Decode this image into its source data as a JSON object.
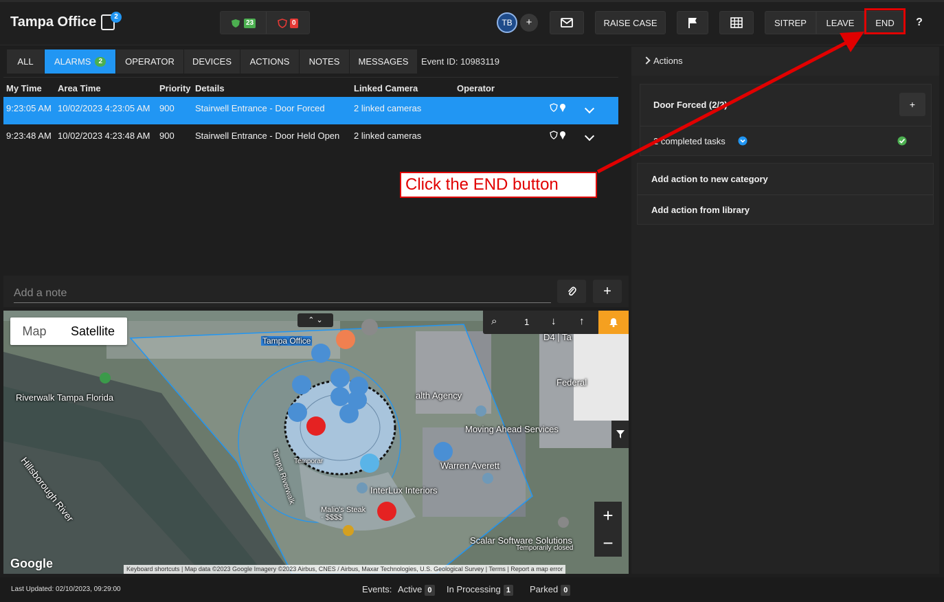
{
  "header": {
    "title": "Tampa Office",
    "notif_count": "2",
    "status_ok_count": "23",
    "status_alert_count": "0",
    "avatar_initials": "TB",
    "avatar_add": "+",
    "raise_case": "RAISE CASE",
    "sitrep": "SITREP",
    "leave": "LEAVE",
    "end": "END",
    "help": "?"
  },
  "tabs": [
    {
      "label": "ALL"
    },
    {
      "label": "ALARMS",
      "badge": "2"
    },
    {
      "label": "OPERATOR"
    },
    {
      "label": "DEVICES"
    },
    {
      "label": "ACTIONS"
    },
    {
      "label": "NOTES"
    },
    {
      "label": "MESSAGES"
    }
  ],
  "event_id": "Event ID: 10983119",
  "table": {
    "headers": [
      "My Time",
      "Area Time",
      "Priority",
      "Details",
      "Linked Camera",
      "Operator"
    ],
    "rows": [
      {
        "my_time": "9:23:05 AM",
        "area_time": "10/02/2023 4:23:05 AM",
        "priority": "900",
        "details": "Stairwell Entrance - Door Forced",
        "camera": "2 linked cameras"
      },
      {
        "my_time": "9:23:48 AM",
        "area_time": "10/02/2023 4:23:48 AM",
        "priority": "900",
        "details": "Stairwell Entrance - Door Held Open",
        "camera": "2 linked cameras"
      }
    ]
  },
  "note": {
    "placeholder": "Add a note",
    "add": "+"
  },
  "map": {
    "toggle_map": "Map",
    "toggle_satellite": "Satellite",
    "zoom_level": "1",
    "labels": {
      "tampa_office": "Tampa Office",
      "riverwalk": "Riverwalk Tampa Florida",
      "river": "Hillsborough River",
      "health": "alth Agency",
      "moving": "Moving Ahead Services",
      "warren": "Warren Averett",
      "interlux": "InterLux Interiors",
      "tampa_riverwalk": "Tampa Riverwalk",
      "malios": "Malio's Steak · $$$$",
      "temporary": "Temporar",
      "scalar": "Scalar Software Solutions",
      "temp_closed": "Temporarily closed",
      "federal": "Federal",
      "d4": "D4 | Ta",
      "google": "Google"
    },
    "attribution": "Keyboard shortcuts | Map data ©2023 Google Imagery ©2023 Airbus, CNES / Airbus, Maxar Technologies, U.S. Geological Survey | Terms | Report a map error",
    "zoom_in": "+",
    "zoom_out": "−"
  },
  "actions_panel": {
    "title": "Actions",
    "category": "Door Forced (2/2)",
    "category_add": "+",
    "completed": "2 completed tasks",
    "add_category": "Add action to new category",
    "add_library": "Add action from library"
  },
  "footer": {
    "last_updated": "Last Updated: 02/10/2023, 09:29:00",
    "events_label": "Events:",
    "active_label": "Active",
    "active_count": "0",
    "processing_label": "In Processing",
    "processing_count": "1",
    "parked_label": "Parked",
    "parked_count": "0"
  },
  "annotation": {
    "text": "Click the END button"
  },
  "colors": {
    "accent": "#2196f3",
    "ok": "#4caf50",
    "alert": "#e53935",
    "annotation": "#e10000"
  }
}
